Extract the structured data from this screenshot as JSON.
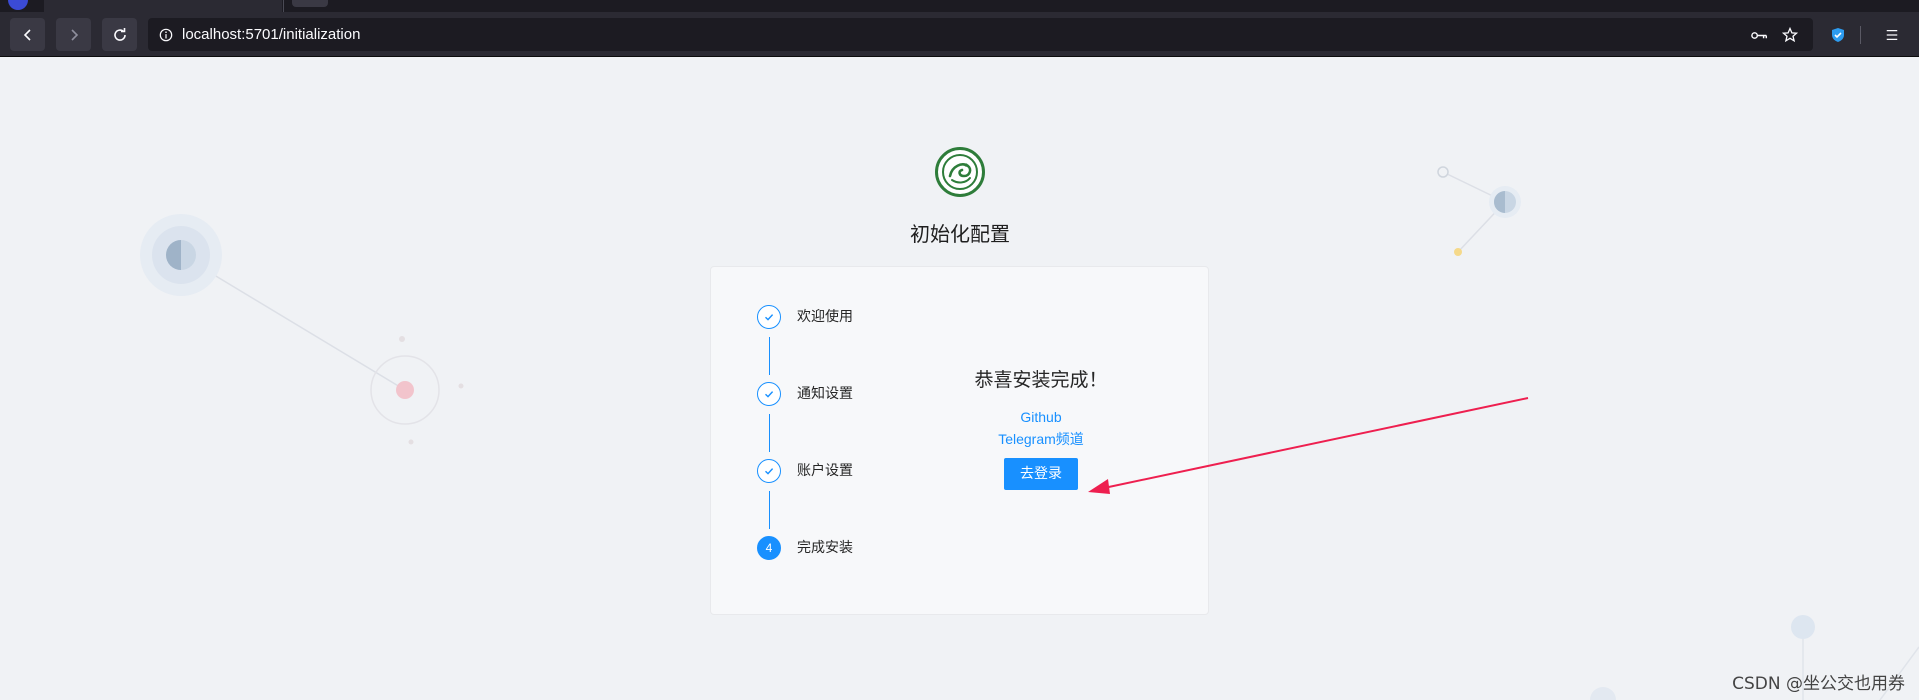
{
  "browser": {
    "url": "localhost:5701/initialization"
  },
  "page": {
    "title": "初始化配置",
    "steps": [
      {
        "label": "欢迎使用",
        "status": "finish"
      },
      {
        "label": "通知设置",
        "status": "finish"
      },
      {
        "label": "账户设置",
        "status": "finish"
      },
      {
        "label": "完成安装",
        "status": "process",
        "number": "4"
      }
    ],
    "result": {
      "message": "恭喜安装完成！",
      "links": [
        "Github",
        "Telegram频道"
      ],
      "login_button": "去登录"
    }
  },
  "watermark": "CSDN @坐公交也用券",
  "colors": {
    "primary": "#1890ff",
    "arrow": "#ee1f4f",
    "logo_green": "#2e7d3a",
    "page_bg": "#f0f2f5"
  }
}
